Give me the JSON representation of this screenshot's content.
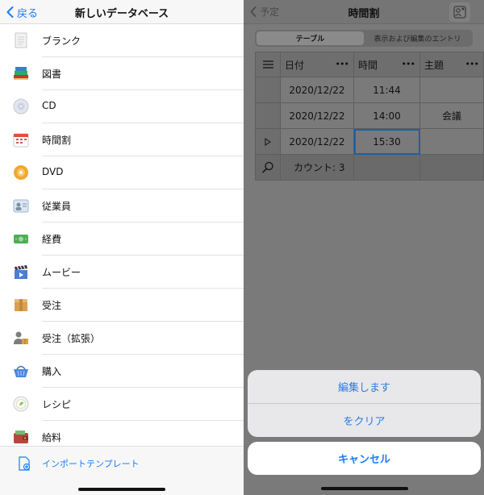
{
  "left": {
    "back_label": "戻る",
    "title": "新しいデータベース",
    "items": [
      {
        "label": "ブランク",
        "icon": "blank-doc-icon"
      },
      {
        "label": "図書",
        "icon": "books-icon"
      },
      {
        "label": "CD",
        "icon": "cd-icon"
      },
      {
        "label": "時間割",
        "icon": "calendar-icon"
      },
      {
        "label": "DVD",
        "icon": "dvd-icon"
      },
      {
        "label": "従業員",
        "icon": "id-card-icon"
      },
      {
        "label": "経費",
        "icon": "money-icon"
      },
      {
        "label": "ムービー",
        "icon": "clapper-icon"
      },
      {
        "label": "受注",
        "icon": "box-icon"
      },
      {
        "label": "受注（拡張）",
        "icon": "person-box-icon"
      },
      {
        "label": "購入",
        "icon": "basket-icon"
      },
      {
        "label": "レシピ",
        "icon": "plate-icon"
      },
      {
        "label": "給料",
        "icon": "wallet-icon"
      }
    ],
    "import_label": "インポートテンプレート"
  },
  "right": {
    "back_label": "予定",
    "title": "時間割",
    "segments": [
      "テーブル",
      "表示および編集のエントリ"
    ],
    "columns": [
      "日付",
      "時間",
      "主題"
    ],
    "rows": [
      {
        "date": "2020/12/22",
        "time": "11:44",
        "subject": ""
      },
      {
        "date": "2020/12/22",
        "time": "14:00",
        "subject": "会議"
      },
      {
        "date": "2020/12/22",
        "time": "15:30",
        "subject": ""
      }
    ],
    "count_label": "カウント: 3",
    "actions": [
      "編集します",
      "をクリア"
    ],
    "cancel_label": "キャンセル"
  },
  "colors": {
    "accent": "#1c7cf4",
    "selected_cell_border": "#1d5fa8"
  }
}
